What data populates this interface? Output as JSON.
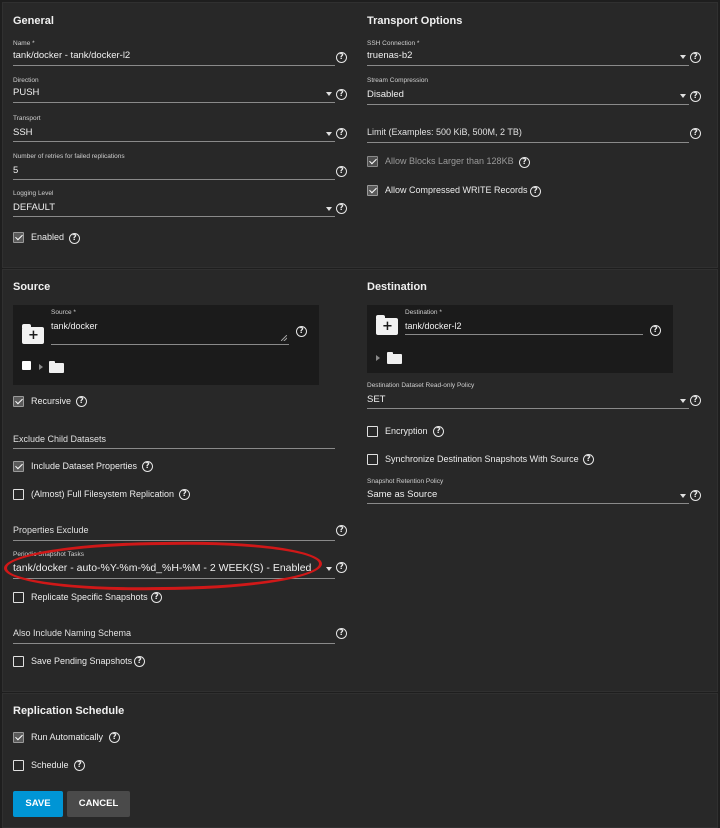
{
  "general": {
    "title": "General",
    "name": {
      "label": "Name *",
      "value": "tank/docker - tank/docker-l2"
    },
    "direction": {
      "label": "Direction",
      "value": "PUSH"
    },
    "transport": {
      "label": "Transport",
      "value": "SSH"
    },
    "retries": {
      "label": "Number of retries for failed replications",
      "value": "5"
    },
    "logging": {
      "label": "Logging Level",
      "value": "DEFAULT"
    },
    "enabled": {
      "label": "Enabled",
      "checked": true
    }
  },
  "transport_options": {
    "title": "Transport Options",
    "ssh_connection": {
      "label": "SSH Connection *",
      "value": "truenas-b2"
    },
    "stream_compression": {
      "label": "Stream Compression",
      "value": "Disabled"
    },
    "limit": {
      "placeholder": "Limit (Examples: 500 KiB, 500M, 2 TB)"
    },
    "allow_blocks": {
      "label": "Allow Blocks Larger than 128KB",
      "checked": true,
      "disabled": true
    },
    "allow_compressed": {
      "label": "Allow Compressed WRITE Records",
      "checked": true
    }
  },
  "source": {
    "title": "Source",
    "source_field": {
      "label": "Source *",
      "value": "tank/docker"
    },
    "recursive": {
      "label": "Recursive",
      "checked": true
    },
    "exclude_child": {
      "placeholder": "Exclude Child Datasets"
    },
    "include_props": {
      "label": "Include Dataset Properties",
      "checked": true
    },
    "full_fs": {
      "label": "(Almost) Full Filesystem Replication",
      "checked": false
    },
    "properties_exclude": {
      "placeholder": "Properties Exclude"
    },
    "periodic_tasks": {
      "label": "Periodic Snapshot Tasks",
      "value": "tank/docker - auto-%Y-%m-%d_%H-%M - 2 WEEK(S) - Enabled"
    },
    "replicate_specific": {
      "label": "Replicate Specific Snapshots",
      "checked": false
    },
    "naming_schema": {
      "placeholder": "Also Include Naming Schema"
    },
    "save_pending": {
      "label": "Save Pending Snapshots",
      "checked": false
    }
  },
  "destination": {
    "title": "Destination",
    "destination_field": {
      "label": "Destination *",
      "value": "tank/docker-l2"
    },
    "readonly_policy": {
      "label": "Destination Dataset Read-only Policy",
      "value": "SET"
    },
    "encryption": {
      "label": "Encryption",
      "checked": false
    },
    "sync_snapshots": {
      "label": "Synchronize Destination Snapshots With Source",
      "checked": false
    },
    "retention": {
      "label": "Snapshot Retention Policy",
      "value": "Same as Source"
    }
  },
  "schedule": {
    "title": "Replication Schedule",
    "run_auto": {
      "label": "Run Automatically",
      "checked": true
    },
    "schedule": {
      "label": "Schedule",
      "checked": false
    }
  },
  "buttons": {
    "save": "SAVE",
    "cancel": "CANCEL"
  },
  "help_glyph": "?",
  "colors": {
    "accent": "#0095d5",
    "annotation": "#d01818",
    "panel": "#282828",
    "background": "#1e1e1e"
  }
}
